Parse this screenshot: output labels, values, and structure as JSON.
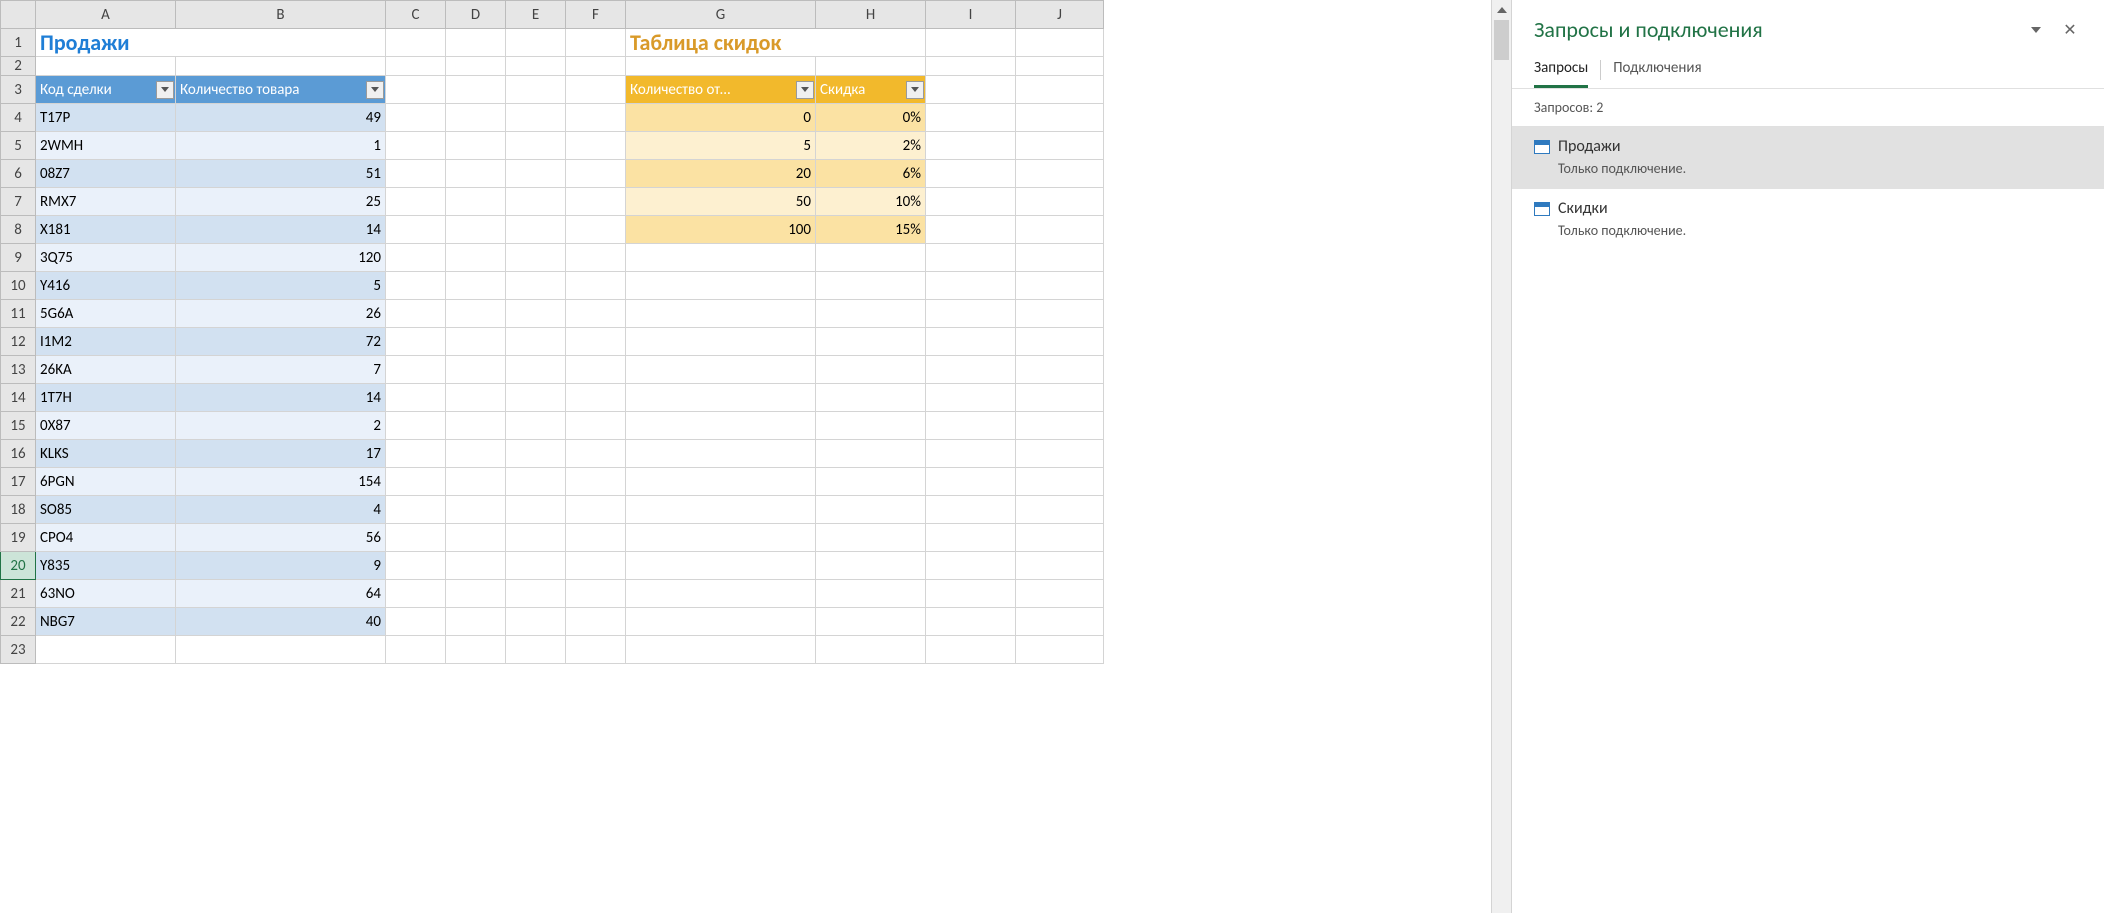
{
  "columns": [
    "A",
    "B",
    "C",
    "D",
    "E",
    "F",
    "G",
    "H",
    "I",
    "J"
  ],
  "col_widths": {
    "A": 140,
    "B": 210,
    "C": 60,
    "D": 60,
    "E": 60,
    "F": 60,
    "G": 190,
    "H": 110,
    "I": 90,
    "J": 88
  },
  "titles": {
    "sales": "Продажи",
    "discounts": "Таблица скидок"
  },
  "sales_table": {
    "headers": [
      "Код сделки",
      "Количество товара"
    ],
    "rows": [
      {
        "code": "T17P",
        "qty": "49"
      },
      {
        "code": "2WMH",
        "qty": "1"
      },
      {
        "code": "08Z7",
        "qty": "51"
      },
      {
        "code": "RMX7",
        "qty": "25"
      },
      {
        "code": "X181",
        "qty": "14"
      },
      {
        "code": "3Q75",
        "qty": "120"
      },
      {
        "code": "Y416",
        "qty": "5"
      },
      {
        "code": "5G6A",
        "qty": "26"
      },
      {
        "code": "I1M2",
        "qty": "72"
      },
      {
        "code": "26KA",
        "qty": "7"
      },
      {
        "code": "1T7H",
        "qty": "14"
      },
      {
        "code": "0X87",
        "qty": "2"
      },
      {
        "code": "KLKS",
        "qty": "17"
      },
      {
        "code": "6PGN",
        "qty": "154"
      },
      {
        "code": "SO85",
        "qty": "4"
      },
      {
        "code": "CPO4",
        "qty": "56"
      },
      {
        "code": "Y835",
        "qty": "9"
      },
      {
        "code": "63NO",
        "qty": "64"
      },
      {
        "code": "NBG7",
        "qty": "40"
      }
    ]
  },
  "discount_table": {
    "headers": [
      "Количество от...",
      "Скидка"
    ],
    "rows": [
      {
        "from": "0",
        "disc": "0%"
      },
      {
        "from": "5",
        "disc": "2%"
      },
      {
        "from": "20",
        "disc": "6%"
      },
      {
        "from": "50",
        "disc": "10%"
      },
      {
        "from": "100",
        "disc": "15%"
      }
    ]
  },
  "panel": {
    "title": "Запросы и подключения",
    "tabs": [
      "Запросы",
      "Подключения"
    ],
    "count_label": "Запросов: 2",
    "queries": [
      {
        "name": "Продажи",
        "sub": "Только подключение."
      },
      {
        "name": "Скидки",
        "sub": "Только подключение."
      }
    ]
  },
  "active_row": 20
}
